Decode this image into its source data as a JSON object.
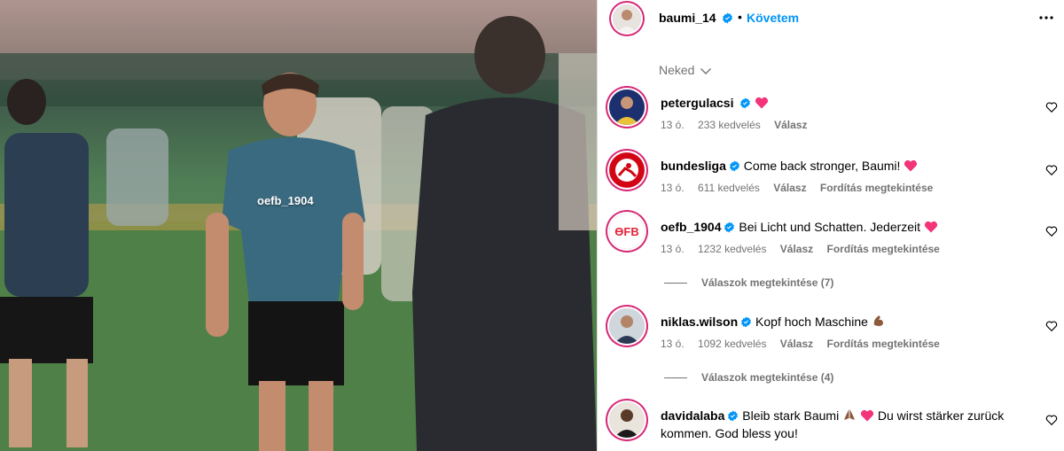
{
  "photo": {
    "tag": "oefb_1904"
  },
  "header": {
    "username": "baumi_14",
    "separator": "•",
    "follow_label": "Követem",
    "more_icon": "more-horizontal-icon"
  },
  "section": {
    "label": "Neked"
  },
  "comments": [
    {
      "username": "petergulacsi",
      "text": "",
      "time": "13 ó.",
      "likes": "233 kedvelés",
      "reply": "Válasz",
      "translate": ""
    },
    {
      "username": "bundesliga",
      "text": "Come back stronger, Baumi!",
      "time": "13 ó.",
      "likes": "611 kedvelés",
      "reply": "Válasz",
      "translate": "Fordítás megtekintése"
    },
    {
      "username": "oefb_1904",
      "text": "Bei Licht und Schatten. Jederzeit",
      "time": "13 ó.",
      "likes": "1232 kedvelés",
      "reply": "Válasz",
      "translate": "Fordítás megtekintése",
      "replies": "Válaszok megtekintése (7)"
    },
    {
      "username": "niklas.wilson",
      "text": "Kopf hoch Maschine",
      "time": "13 ó.",
      "likes": "1092 kedvelés",
      "reply": "Válasz",
      "translate": "Fordítás megtekintése",
      "replies": "Válaszok megtekintése (4)"
    },
    {
      "username": "davidalaba",
      "text_a": "Bleib stark Baumi",
      "text_b": "Du wirst stärker zurück kommen. God bless you!"
    }
  ],
  "colors": {
    "accent": "#0095f6",
    "verified": "#0095f6",
    "heart": "#ed4956",
    "muted": "#737373"
  }
}
